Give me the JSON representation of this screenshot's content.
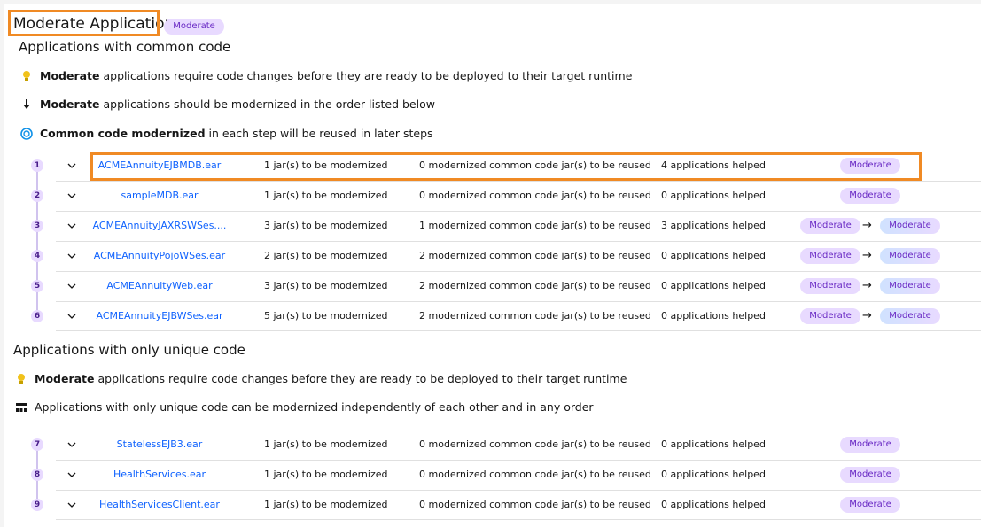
{
  "header": {
    "title": "Moderate Applications",
    "badge": "Moderate"
  },
  "common_section": {
    "heading": "Applications with common code",
    "notes": [
      {
        "icon": "lightbulb-icon",
        "bold": "Moderate",
        "text": "applications require code changes before they are ready to be deployed to their target runtime"
      },
      {
        "icon": "arrow-down-icon",
        "bold": "Moderate",
        "text": "applications should be modernized in the order listed below"
      },
      {
        "icon": "reuse-icon",
        "bold": "Common code modernized",
        "text": "in each step will be reused in later steps"
      }
    ],
    "rows": [
      {
        "step": "1",
        "name": "ACMEAnnuityEJBMDB.ear",
        "jars": "1 jar(s) to be modernized",
        "common": "0 modernized common code jar(s) to be reused",
        "helped": "4 applications helped",
        "from": "",
        "to": "Moderate"
      },
      {
        "step": "2",
        "name": "sampleMDB.ear",
        "jars": "1 jar(s) to be modernized",
        "common": "0 modernized common code jar(s) to be reused",
        "helped": "0 applications helped",
        "from": "",
        "to": "Moderate"
      },
      {
        "step": "3",
        "name": "ACMEAnnuityJAXRSWSes....",
        "jars": "3 jar(s) to be modernized",
        "common": "1 modernized common code jar(s) to be reused",
        "helped": "3 applications helped",
        "from": "Moderate",
        "to": "Moderate"
      },
      {
        "step": "4",
        "name": "ACMEAnnuityPojoWSes.ear",
        "jars": "2 jar(s) to be modernized",
        "common": "2 modernized common code jar(s) to be reused",
        "helped": "0 applications helped",
        "from": "Moderate",
        "to": "Moderate"
      },
      {
        "step": "5",
        "name": "ACMEAnnuityWeb.ear",
        "jars": "3 jar(s) to be modernized",
        "common": "2 modernized common code jar(s) to be reused",
        "helped": "0 applications helped",
        "from": "Moderate",
        "to": "Moderate"
      },
      {
        "step": "6",
        "name": "ACMEAnnuityEJBWSes.ear",
        "jars": "5 jar(s) to be modernized",
        "common": "2 modernized common code jar(s) to be reused",
        "helped": "0 applications helped",
        "from": "Moderate",
        "to": "Moderate"
      }
    ]
  },
  "unique_section": {
    "heading": "Applications with only unique code",
    "notes": [
      {
        "icon": "lightbulb-icon",
        "bold": "Moderate",
        "text": "applications require code changes before they are ready to be deployed to their target runtime"
      },
      {
        "icon": "order-icon",
        "bold": "",
        "text": "Applications with only unique code can be modernized independently of each other and in any order"
      }
    ],
    "rows": [
      {
        "step": "7",
        "name": "StatelessEJB3.ear",
        "jars": "1 jar(s) to be modernized",
        "common": "0 modernized common code jar(s) to be reused",
        "helped": "0 applications helped",
        "to": "Moderate"
      },
      {
        "step": "8",
        "name": "HealthServices.ear",
        "jars": "1 jar(s) to be modernized",
        "common": "0 modernized common code jar(s) to be reused",
        "helped": "0 applications helped",
        "to": "Moderate"
      },
      {
        "step": "9",
        "name": "HealthServicesClient.ear",
        "jars": "1 jar(s) to be modernized",
        "common": "0 modernized common code jar(s) to be reused",
        "helped": "0 applications helped",
        "to": "Moderate"
      }
    ]
  },
  "colors": {
    "accent": "#0f62fe",
    "tag_bg": "#e8daff",
    "tag_text": "#6929c4",
    "highlight": "#f08a24"
  }
}
